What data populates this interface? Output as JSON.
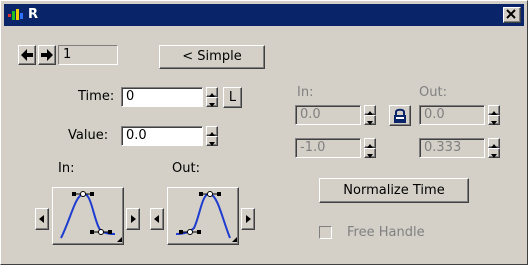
{
  "window": {
    "title": "R"
  },
  "nav": {
    "key_index": "1",
    "mode_button": "< Simple"
  },
  "time": {
    "label": "Time:",
    "value": "0",
    "lock_label": "L"
  },
  "value": {
    "label": "Value:",
    "value": "0.0"
  },
  "tangents": {
    "in_label": "In:",
    "out_label": "Out:"
  },
  "right_panel": {
    "in_label": "In:",
    "out_label": "Out:",
    "in_value": "0.0",
    "in_length": "-1.0",
    "out_value": "0.0",
    "out_length": "0.333",
    "normalize_button": "Normalize Time",
    "free_handle_label": "Free Handle"
  },
  "icons": {
    "app": "app-logo-icon",
    "lock": "lock-icon"
  },
  "colors": {
    "titlebar": "#0a246a",
    "face": "#d4d0c8",
    "lock": "#0a246a"
  }
}
